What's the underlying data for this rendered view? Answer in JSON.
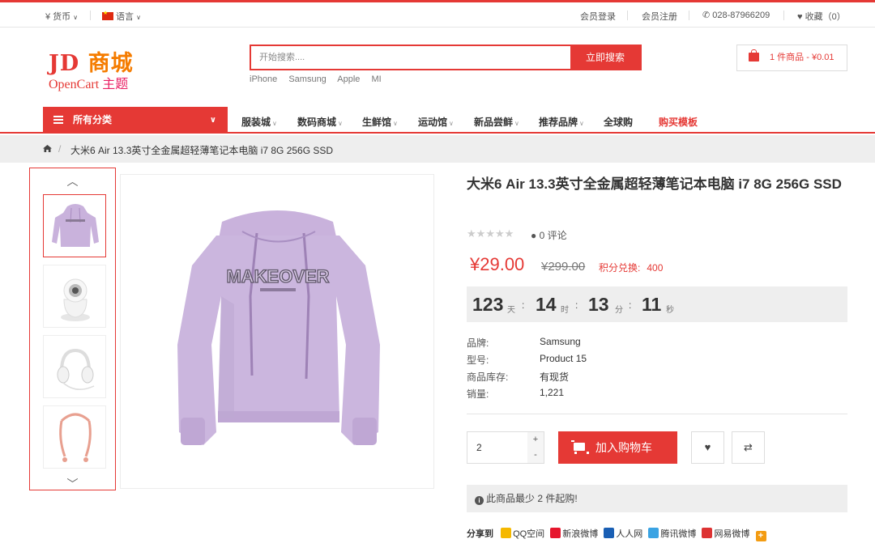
{
  "topbar": {
    "currency": "¥ 货币",
    "language": "语言",
    "login": "会员登录",
    "register": "会员注册",
    "phone": "028-87966209",
    "favorites": "收藏（0）"
  },
  "logo": {
    "jd": "JD",
    "jd_cn": "商城",
    "opencart": "OpenCart",
    "opencart_cn": "主题"
  },
  "search": {
    "placeholder": "开始搜索....",
    "button": "立即搜索",
    "hotwords": [
      "iPhone",
      "Samsung",
      "Apple",
      "MI"
    ]
  },
  "cart": {
    "summary": "1 件商品 - ¥0.01"
  },
  "nav": {
    "all_categories": "所有分类",
    "items": [
      "服装城",
      "数码商城",
      "生鲜馆",
      "运动馆",
      "新品尝鲜",
      "推荐品牌",
      "全球购",
      "购买模板"
    ]
  },
  "breadcrumb": {
    "current": "大米6 Air 13.3英寸全金属超轻薄笔记本电脑 i7 8G 256G SSD"
  },
  "product": {
    "title": "大米6 Air 13.3英寸全金属超轻薄笔记本电脑 i7 8G 256G SSD",
    "rating": 0,
    "reviews": "0 评论",
    "price": "¥29.00",
    "old_price": "¥299.00",
    "points_label": "积分兑换:",
    "points_value": "400",
    "countdown": {
      "days": "123",
      "days_unit": "天",
      "hours": "14",
      "hours_unit": "时",
      "minutes": "13",
      "minutes_unit": "分",
      "seconds": "11",
      "seconds_unit": "秒"
    },
    "specs": [
      {
        "k": "品牌:",
        "v": "Samsung"
      },
      {
        "k": "型号:",
        "v": "Product 15"
      },
      {
        "k": "商品库存:",
        "v": "有现货"
      },
      {
        "k": "销量:",
        "v": "1,221"
      }
    ],
    "quantity": "2",
    "add_to_cart": "加入购物车",
    "min_notice": "此商品最少 2 件起购!",
    "image_text": "MAKEOVER"
  },
  "thumbs": [
    "hoodie",
    "camera",
    "headphones",
    "neckband-earphones"
  ],
  "share": {
    "label": "分享到",
    "sites": [
      "QQ空间",
      "新浪微博",
      "人人网",
      "腾讯微博",
      "网易微博"
    ]
  },
  "colors": {
    "accent": "#e53935",
    "hoodie": "#c9b2dc"
  }
}
